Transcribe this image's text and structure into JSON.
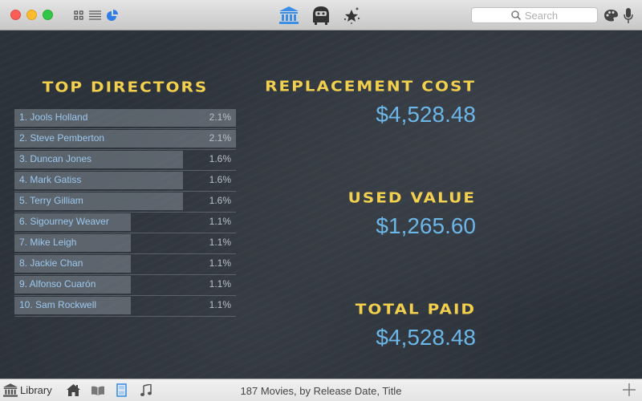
{
  "toolbar": {
    "search_placeholder": "Search",
    "view_icons": [
      "grid-view-icon",
      "list-view-icon",
      "pie-chart-icon"
    ],
    "center_icons": [
      "library-icon",
      "robot-icon",
      "stars-icon"
    ],
    "right_icons": [
      "palette-icon",
      "microphone-icon"
    ],
    "accent_color": "#3a8ee6"
  },
  "directors": {
    "title": "Top Directors",
    "items": [
      {
        "label": "1. Jools Holland",
        "percent": "2.1%",
        "share": 2.1
      },
      {
        "label": "2. Steve Pemberton",
        "percent": "2.1%",
        "share": 2.1
      },
      {
        "label": "3. Duncan Jones",
        "percent": "1.6%",
        "share": 1.6
      },
      {
        "label": "4. Mark Gatiss",
        "percent": "1.6%",
        "share": 1.6
      },
      {
        "label": "5. Terry Gilliam",
        "percent": "1.6%",
        "share": 1.6
      },
      {
        "label": "6. Sigourney Weaver",
        "percent": "1.1%",
        "share": 1.1
      },
      {
        "label": "7. Mike Leigh",
        "percent": "1.1%",
        "share": 1.1
      },
      {
        "label": "8. Jackie Chan",
        "percent": "1.1%",
        "share": 1.1
      },
      {
        "label": "9. Alfonso Cuarón",
        "percent": "1.1%",
        "share": 1.1
      },
      {
        "label": "10. Sam Rockwell",
        "percent": "1.1%",
        "share": 1.1
      }
    ]
  },
  "stats": {
    "replacement_cost": {
      "label": "Replacement Cost",
      "value": "$4,528.48"
    },
    "used_value": {
      "label": "Used Value",
      "value": "$1,265.60"
    },
    "total_paid": {
      "label": "Total Paid",
      "value": "$4,528.48"
    }
  },
  "bottombar": {
    "library_label": "Library",
    "status": "187 Movies,  by Release Date, Title",
    "icons": [
      "home-icon",
      "book-icon",
      "film-icon",
      "music-icon"
    ],
    "add_icon": "plus-icon"
  }
}
